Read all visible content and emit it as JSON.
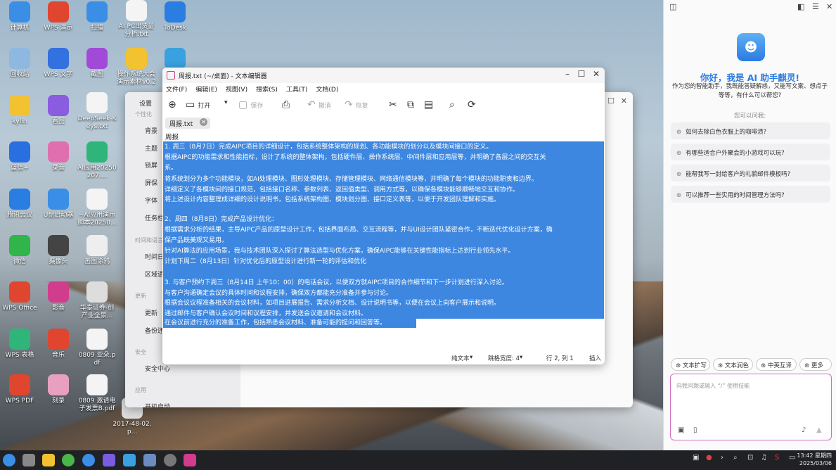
{
  "desktop": {
    "icons": [
      {
        "label": "计算机",
        "color": "#3a8ee6"
      },
      {
        "label": "WPS 演示",
        "color": "#e0452f"
      },
      {
        "label": "扫描",
        "color": "#3a8ee6"
      },
      {
        "label": "AI PC出货量分析.txt",
        "color": "#f4f4f4"
      },
      {
        "label": "ToDesk",
        "color": "#2a7de1"
      },
      {
        "label": "回收站",
        "color": "#8fb8e0"
      },
      {
        "label": "WPS 文字",
        "color": "#3370e0"
      },
      {
        "label": "截图",
        "color": "#a24ad8"
      },
      {
        "label": "操作系统大会演示素材v0.2",
        "color": "#f2c230"
      },
      {
        "label": "",
        "color": "#3aa1e0"
      },
      {
        "label": "kylin",
        "color": "#f2c230"
      },
      {
        "label": "看图",
        "color": "#8a5ce0"
      },
      {
        "label": "DeepSeek-Keys.txt",
        "color": "#f4f4f4"
      },
      {
        "label": "蓝信+",
        "color": "#2a6fe0"
      },
      {
        "label": "录音",
        "color": "#e06fb0"
      },
      {
        "label": "AI应用20250207....",
        "color": "#2fb57a"
      },
      {
        "label": "腾讯会议",
        "color": "#2a7de1"
      },
      {
        "label": "U盘启动器",
        "color": "#3a8ee6"
      },
      {
        "label": "~AI应用演示脚本20250...",
        "color": "#f4f4f4"
      },
      {
        "label": "微信",
        "color": "#2fb54a"
      },
      {
        "label": "摄像头",
        "color": "#444"
      },
      {
        "label": "画图涂鸦",
        "color": "#eee"
      },
      {
        "label": "WPS Office",
        "color": "#e0452f"
      },
      {
        "label": "影音",
        "color": "#d23c8c"
      },
      {
        "label": "华泰证券-创产业全景...",
        "color": "#ddd"
      },
      {
        "label": "WPS 表格",
        "color": "#2fb57a"
      },
      {
        "label": "音乐",
        "color": "#e0452f"
      },
      {
        "label": "0809 亚朵.pdf",
        "color": "#f4f4f4"
      },
      {
        "label": "WPS PDF",
        "color": "#e0452f"
      },
      {
        "label": "刻录",
        "color": "#e8a0c0"
      },
      {
        "label": "0809 邀请电子发票B.pdf",
        "color": "#f4f4f4"
      },
      {
        "label": "2017-48-02.p...",
        "color": "#ddd"
      }
    ]
  },
  "settings": {
    "title": "设置",
    "items": [
      "个性化",
      "背景",
      "主题",
      "锁屏",
      "屏保",
      "字体",
      "任务栏",
      "时间和语言",
      "时间日期",
      "区域语言",
      "更新",
      "更新",
      "备份还原",
      "安全",
      "安全中心",
      "应用",
      "开机启动"
    ]
  },
  "editor": {
    "title": "周报.txt (~/桌面) - 文本编辑器",
    "menus": [
      "文件(F)",
      "编辑(E)",
      "视图(V)",
      "搜索(S)",
      "工具(T)",
      "文档(D)"
    ],
    "toolbar": {
      "open": "打开",
      "save": "保存",
      "undo": "撤消",
      "redo": "恢复"
    },
    "tab": "周报.txt",
    "doc_title": "周报",
    "lines": [
      "1. 周三（8月7日）完成AIPC项目的详细设计，包括系统整体架构的规划、各功能模块的划分以及模块间接口的定义。",
      "   根据AIPC的功能需求和性能指标，设计了系统的整体架构，包括硬件层、操作系统层、中间件层和应用层等，并明确了各层之间的交互关",
      "系。",
      "   将系统划分为多个功能模块，如AI处理模块、图形处理模块、存储管理模块、网络通信模块等，并明确了每个模块的功能职责和边界。",
      "   详细定义了各模块间的接口规范，包括接口名称、参数列表、返回值类型、调用方式等，以确保各模块能够顺畅地交互和协作。",
      "   将上述设计内容整理成详细的设计说明书，包括系统架构图、模块划分图、接口定义表等，以便于开发团队理解和实施。",
      "",
      "2、周四（8月8日）完成产品设计优化：",
      "   根据需求分析的结果，主导AIPC产品的原型设计工作，包括界面布局、交互流程等，并与UI设计团队紧密合作，不断迭代优化设计方案，确",
      "保产品既美观又易用。",
      "   针对AI算法的应用场景，我与技术团队深入探讨了算法选型与优化方案，确保AIPC能够在关键性能指标上达到行业领先水平。",
      "   计划下周二（8月13日）针对优化后的原型设计进行新一轮的评估和优化",
      "",
      "3. 与客户预约下周三（8月14日 上午10：00）的电话会议，以便双方就AIPC项目的合作细节和下一步计划进行深入讨论。",
      "   与客户沟通确定会议的具体时间和议程安排，确保双方都能充分准备并参与讨论。",
      "   根据会议议程准备相关的会议材料，如项目进展报告、需求分析文档、设计说明书等，以便在会议上向客户展示和说明。",
      "   通过邮件与客户确认会议时间和议程安排，并发送会议邀请和会议材料。",
      "   在会议前进行充分的准备工作，包括熟悉会议材料、准备可能的提问和回答等。"
    ],
    "status": {
      "format": "纯文本",
      "tab_width": "跳格宽度: 4",
      "position": "行 2, 列 1",
      "mode": "插入"
    }
  },
  "ai": {
    "greeting": "你好，我是 AI 助手麒灵!",
    "subtitle": "作为您的智能助手，我既能答疑解惑，又能写文案、想点子等等，有什么可以帮您?",
    "ask": "您可以问我:",
    "suggestions": [
      "如何去除白色衣服上的咖啡渍?",
      "有哪些适合户外聚会的小游戏可以玩?",
      "能帮我写一封给客户的礼貌邮件模板吗?",
      "可以推荐一些实用的时间管理方法吗?"
    ],
    "chips": [
      "文本扩写",
      "文本润色",
      "中英互译",
      "更多"
    ],
    "placeholder": "向我问题或输入 “/” 使用技能"
  },
  "taskbar": {
    "time": "13:42 星期四",
    "date": "2025/03/06"
  }
}
